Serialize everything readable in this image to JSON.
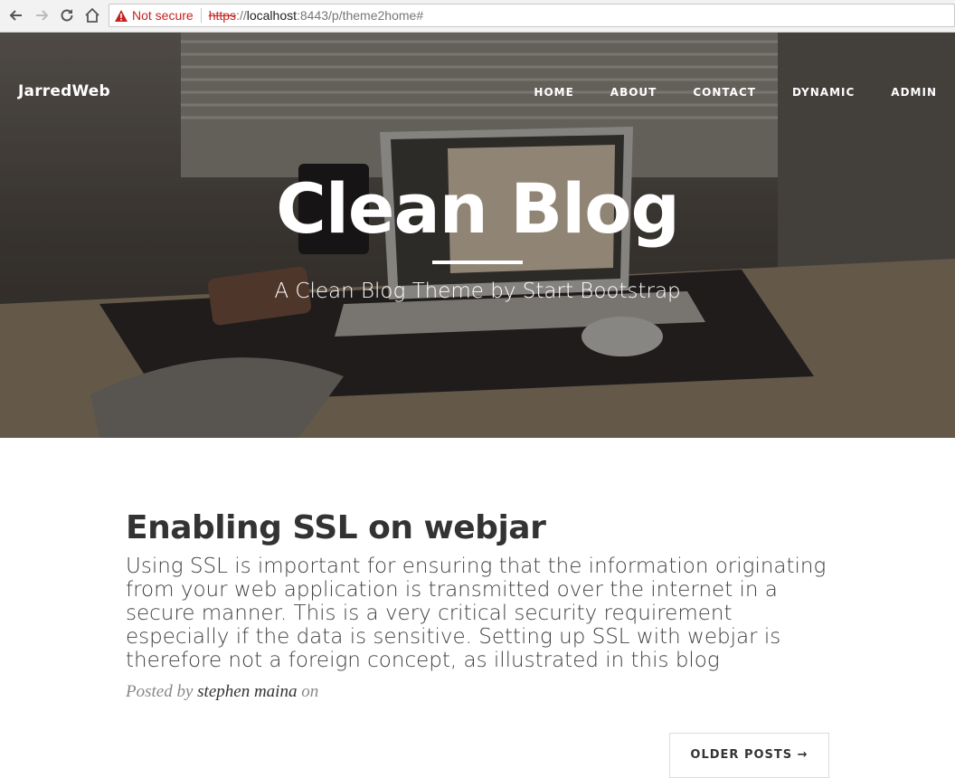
{
  "browser": {
    "security_label": "Not secure",
    "url_scheme": "https",
    "url_sep": "://",
    "url_host": "localhost",
    "url_rest": ":8443/p/theme2home#"
  },
  "nav": {
    "brand": "JarredWeb",
    "items": [
      {
        "label": "HOME"
      },
      {
        "label": "ABOUT"
      },
      {
        "label": "CONTACT"
      },
      {
        "label": "DYNAMIC"
      },
      {
        "label": "ADMIN"
      }
    ]
  },
  "hero": {
    "title": "Clean Blog",
    "subtitle": "A Clean Blog Theme by Start Bootstrap"
  },
  "post": {
    "title": "Enabling SSL on webjar",
    "subtitle": "Using SSL is important for ensuring that the information originating from your web application is transmitted over the internet in a secure manner. This is a very critical security requirement especially if the data is sensitive. Setting up SSL with webjar is therefore not a foreign concept, as illustrated in this blog",
    "posted_by": "Posted by",
    "author": "stephen maina",
    "on": "on"
  },
  "pager": {
    "older_label": "OLDER POSTS →"
  },
  "colors": {
    "hero_overlay": "#3b3632",
    "text_dark": "#333333",
    "warning_red": "#c5221f"
  }
}
